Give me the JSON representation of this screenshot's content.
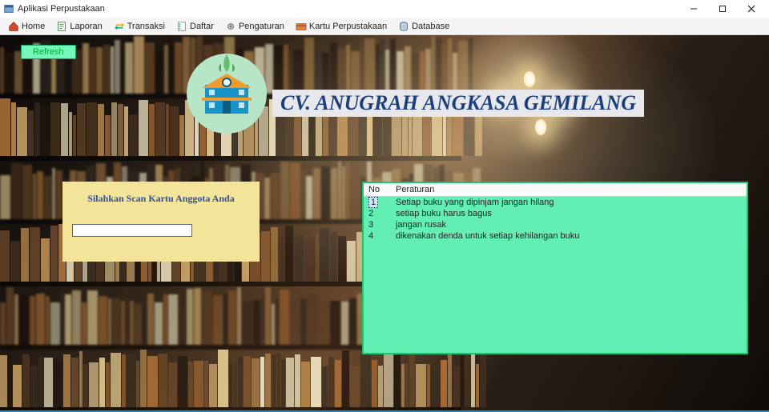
{
  "window": {
    "title": "Aplikasi Perpustakaan"
  },
  "menu": {
    "home": "Home",
    "laporan": "Laporan",
    "transaksi": "Transaksi",
    "daftar": "Daftar",
    "pengaturan": "Pengaturan",
    "kartu": "Kartu Perpustakaan",
    "database": "Database"
  },
  "refresh_label": "Refresh",
  "org_title": "CV. ANUGRAH ANGKASA GEMILANG",
  "scan": {
    "prompt": "Silahkan Scan Kartu Anggota Anda",
    "value": ""
  },
  "rules": {
    "headers": {
      "no": "No",
      "text": "Peraturan"
    },
    "rows": [
      {
        "no": "1",
        "text": "Setiap buku yang dipinjam jangan hilang"
      },
      {
        "no": "2",
        "text": "setiap buku harus bagus"
      },
      {
        "no": "3",
        "text": "jangan rusak"
      },
      {
        "no": "4",
        "text": "dikenakan denda untuk setiap kehilangan buku"
      }
    ]
  }
}
